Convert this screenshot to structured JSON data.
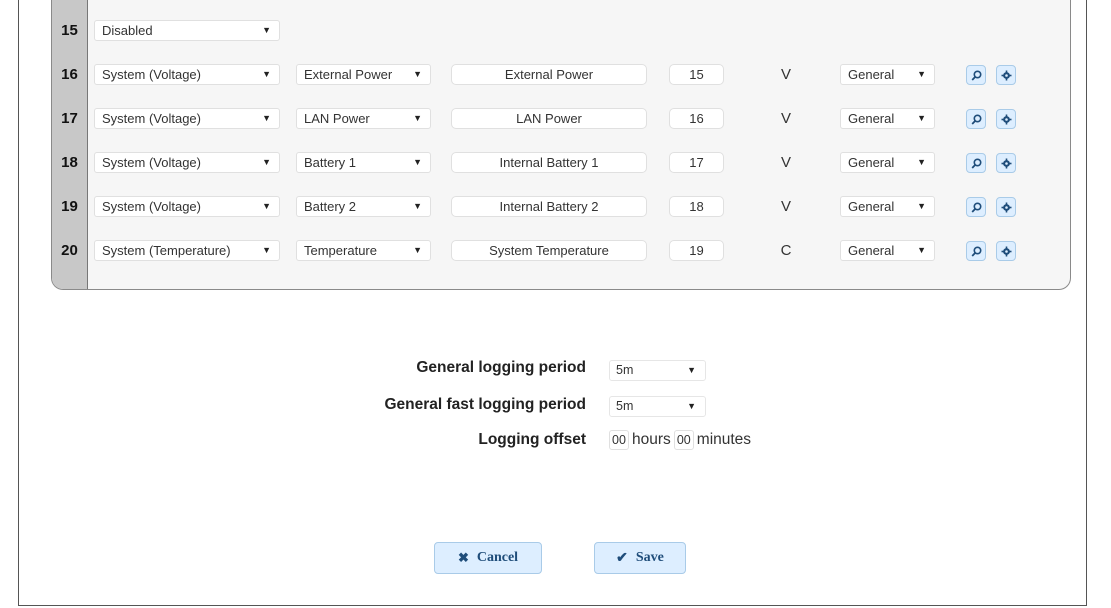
{
  "rows": [
    {
      "num": "15",
      "source": "Disabled"
    },
    {
      "num": "16",
      "source": "System (Voltage)",
      "channel": "External Power",
      "name": "External Power",
      "index": "15",
      "unit": "V",
      "group": "General"
    },
    {
      "num": "17",
      "source": "System (Voltage)",
      "channel": "LAN Power",
      "name": "LAN Power",
      "index": "16",
      "unit": "V",
      "group": "General"
    },
    {
      "num": "18",
      "source": "System (Voltage)",
      "channel": "Battery 1",
      "name": "Internal Battery 1",
      "index": "17",
      "unit": "V",
      "group": "General"
    },
    {
      "num": "19",
      "source": "System (Voltage)",
      "channel": "Battery 2",
      "name": "Internal Battery 2",
      "index": "18",
      "unit": "V",
      "group": "General"
    },
    {
      "num": "20",
      "source": "System (Temperature)",
      "channel": "Temperature",
      "name": "System Temperature",
      "index": "19",
      "unit": "C",
      "group": "General"
    }
  ],
  "icons": {
    "inspect": "search-icon",
    "settings": "gear-icon"
  },
  "logging": {
    "general_period_label": "General logging period",
    "general_period_value": "5m",
    "fast_period_label": "General fast logging period",
    "fast_period_value": "5m",
    "offset_label": "Logging offset",
    "offset_hours": "00",
    "hours_word": "hours",
    "offset_minutes": "00",
    "minutes_word": "minutes"
  },
  "actions": {
    "cancel_label": "Cancel",
    "save_label": "Save"
  },
  "colors": {
    "button_bg": "#ddeeff",
    "button_border": "#a9cbe8",
    "button_text": "#1f4d7a"
  }
}
